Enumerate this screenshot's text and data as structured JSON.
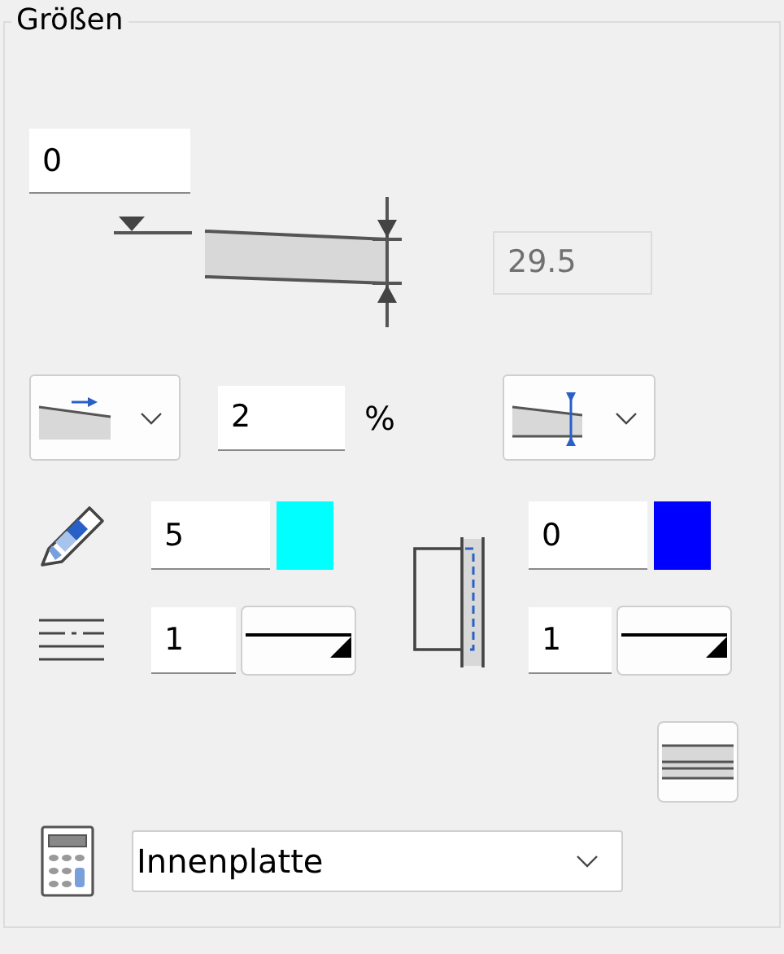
{
  "group": {
    "title": "Größen"
  },
  "elevation": {
    "value": "0"
  },
  "thickness": {
    "value": "29.5",
    "disabled": true
  },
  "slope": {
    "value": "2",
    "unit": "%"
  },
  "pen_left": {
    "value": "5",
    "color": "#00ffff"
  },
  "pen_right": {
    "value": "0",
    "color": "#0000ff"
  },
  "line_left": {
    "value": "1"
  },
  "line_right": {
    "value": "1"
  },
  "material": {
    "value": "Innenplatte"
  }
}
